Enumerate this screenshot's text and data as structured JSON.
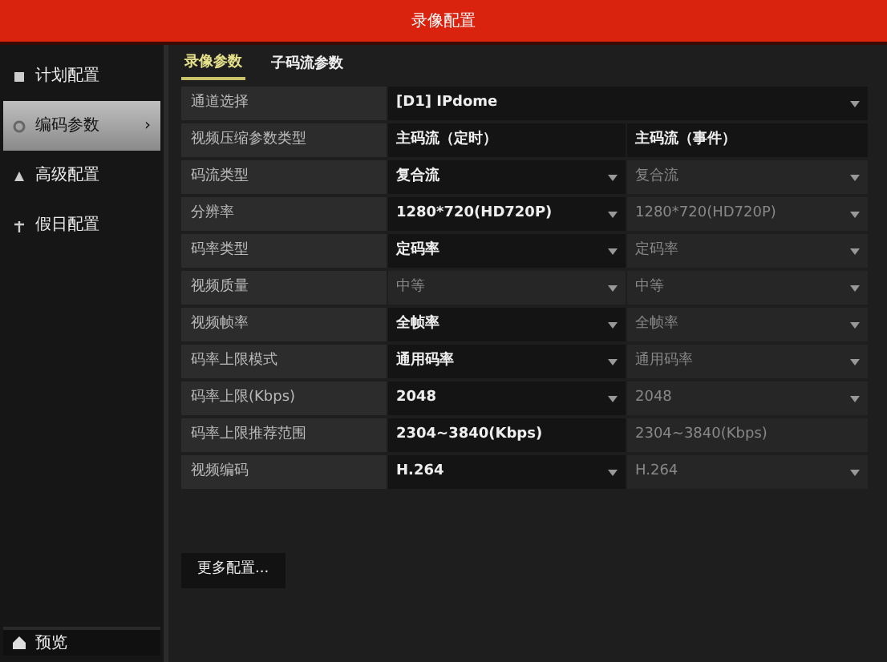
{
  "window": {
    "title": "录像配置"
  },
  "sidebar": {
    "items": [
      {
        "label": "计划配置",
        "selected": false
      },
      {
        "label": "编码参数",
        "selected": true,
        "arrow": "›"
      },
      {
        "label": "高级配置",
        "selected": false
      },
      {
        "label": "假日配置",
        "selected": false
      }
    ],
    "footer": {
      "label": "预览"
    }
  },
  "tabs": [
    {
      "label": "录像参数",
      "selected": true
    },
    {
      "label": "子码流参数",
      "selected": false
    }
  ],
  "channel": {
    "label": "通道选择",
    "value": "[D1] IPdome"
  },
  "header": {
    "label": "视频压缩参数类型",
    "columns": [
      "主码流（定时）",
      "主码流（事件）"
    ]
  },
  "rows": [
    {
      "label": "码流类型",
      "cells": [
        {
          "value": "复合流",
          "dropdown": true,
          "disabled": false
        },
        {
          "value": "复合流",
          "dropdown": true,
          "disabled": true
        }
      ]
    },
    {
      "label": "分辨率",
      "cells": [
        {
          "value": "1280*720(HD720P)",
          "dropdown": true,
          "disabled": false
        },
        {
          "value": "1280*720(HD720P)",
          "dropdown": true,
          "disabled": true
        }
      ]
    },
    {
      "label": "码率类型",
      "cells": [
        {
          "value": "定码率",
          "dropdown": true,
          "disabled": false
        },
        {
          "value": "定码率",
          "dropdown": true,
          "disabled": true
        }
      ]
    },
    {
      "label": "视频质量",
      "cells": [
        {
          "value": "中等",
          "dropdown": true,
          "disabled": true
        },
        {
          "value": "中等",
          "dropdown": true,
          "disabled": true
        }
      ]
    },
    {
      "label": "视频帧率",
      "cells": [
        {
          "value": "全帧率",
          "dropdown": true,
          "disabled": false
        },
        {
          "value": "全帧率",
          "dropdown": true,
          "disabled": true
        }
      ]
    },
    {
      "label": "码率上限模式",
      "cells": [
        {
          "value": "通用码率",
          "dropdown": true,
          "disabled": false
        },
        {
          "value": "通用码率",
          "dropdown": true,
          "disabled": true
        }
      ]
    },
    {
      "label": "码率上限(Kbps)",
      "cells": [
        {
          "value": "2048",
          "dropdown": true,
          "disabled": false
        },
        {
          "value": "2048",
          "dropdown": true,
          "disabled": true
        }
      ]
    },
    {
      "label": "码率上限推荐范围",
      "cells": [
        {
          "value": "2304~3840(Kbps)",
          "dropdown": false,
          "disabled": false
        },
        {
          "value": "2304~3840(Kbps)",
          "dropdown": false,
          "disabled": true
        }
      ]
    },
    {
      "label": "视频编码",
      "cells": [
        {
          "value": "H.264",
          "dropdown": true,
          "disabled": false
        },
        {
          "value": "H.264",
          "dropdown": true,
          "disabled": true
        }
      ]
    }
  ],
  "more_button": {
    "label": "更多配置..."
  }
}
